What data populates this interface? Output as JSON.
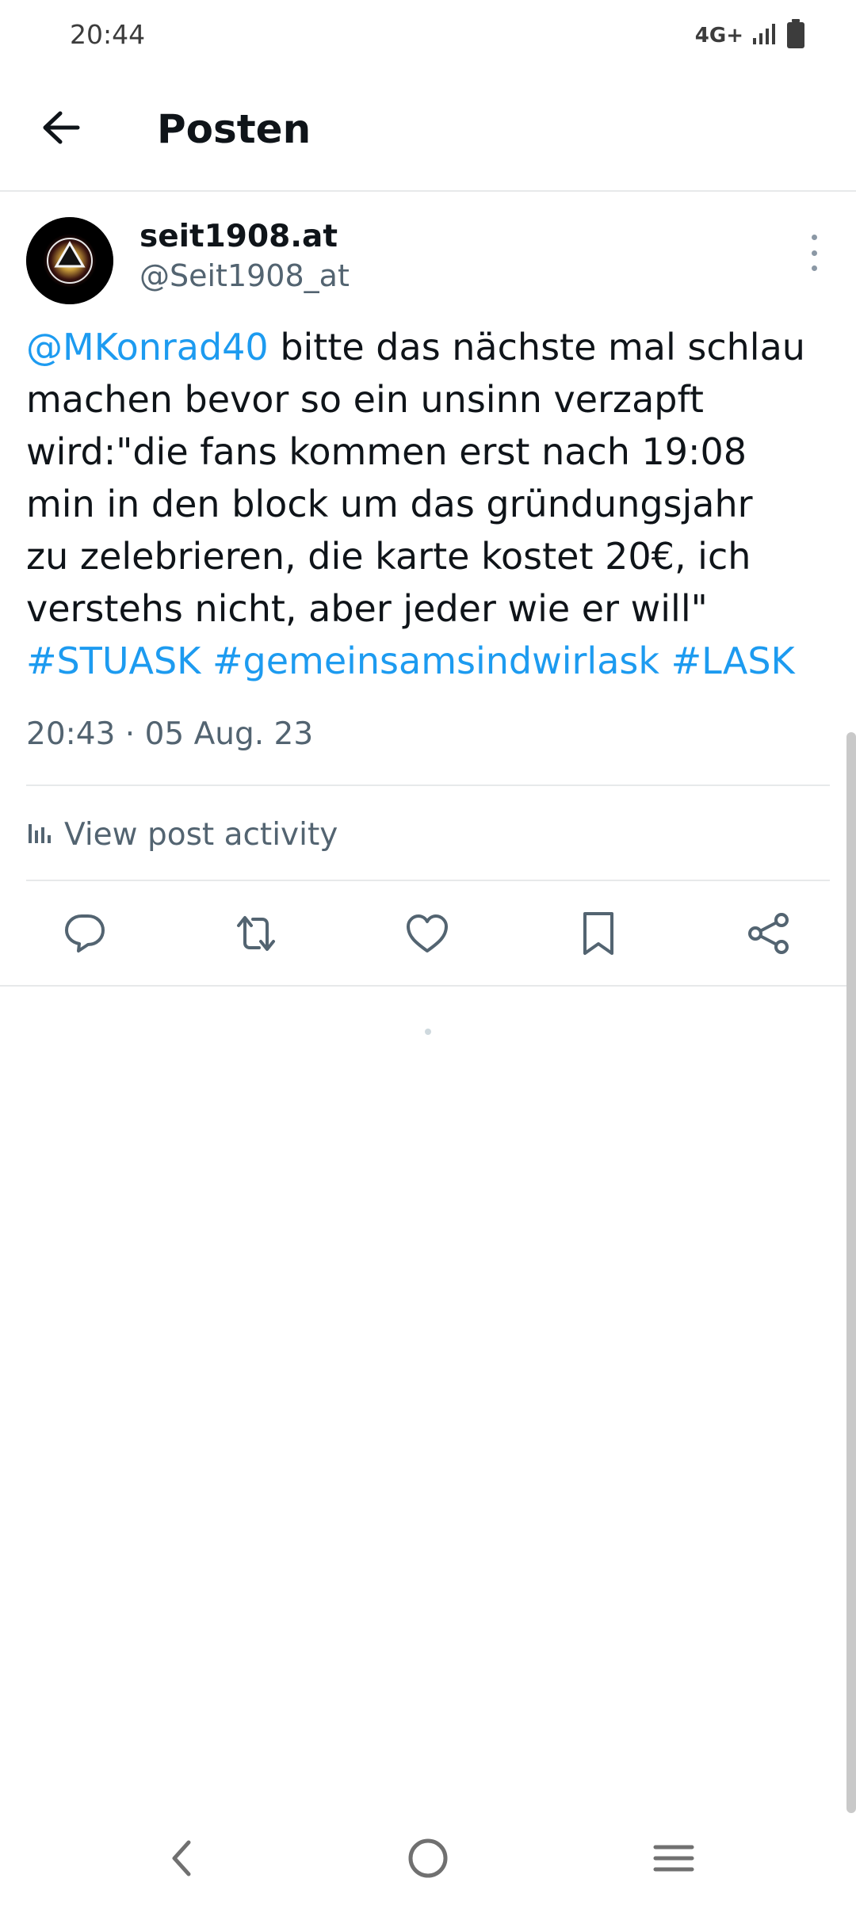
{
  "status_bar": {
    "time": "20:44",
    "network": "4G+",
    "icons": [
      "signal-icon",
      "battery-icon"
    ]
  },
  "header": {
    "title": "Posten",
    "back_icon": "arrow-left-icon"
  },
  "post": {
    "display_name": "seit1908.at",
    "handle": "@Seit1908_at",
    "text_lines": [
      {
        "mention": "@MKonrad40",
        "rest": " bitte das nächste mal schlau"
      },
      {
        "text": "machen bevor so ein unsinn verzapft"
      },
      {
        "text": "wird:\"die fans kommen erst nach 19:08"
      },
      {
        "text": "min in den block um das gründungsjahr"
      },
      {
        "text": "zu zelebrieren, die karte kostet 20€, ich"
      },
      {
        "text": "verstehs nicht, aber jeder wie er will\""
      },
      {
        "hashtags": [
          "#STUASK",
          "#gemeinsamsindwirlask",
          "#LASK"
        ]
      }
    ],
    "timestamp": "20:43 · 05 Aug. 23",
    "activity_label": "View post activity",
    "actions": [
      "reply-icon",
      "repost-icon",
      "like-icon",
      "bookmark-icon",
      "share-icon"
    ]
  },
  "nav": {
    "icons": [
      "nav-back-icon",
      "nav-home-icon",
      "nav-recents-icon"
    ]
  },
  "colors": {
    "accent": "#1d9bf0",
    "secondary_text": "#536471",
    "primary_text": "#0f1419",
    "divider": "#e7e9ea"
  }
}
